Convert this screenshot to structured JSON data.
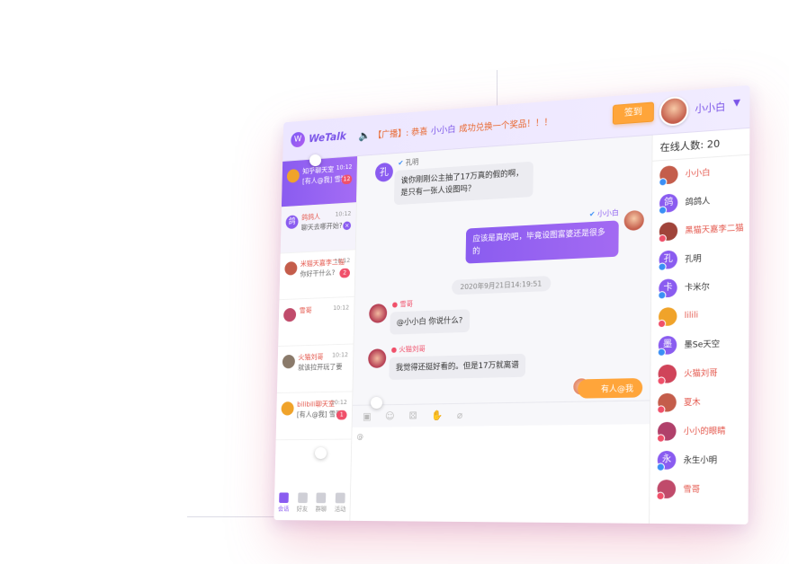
{
  "app": {
    "name": "WeTalk",
    "logo_glyph": "W"
  },
  "topbar": {
    "broadcast_prefix": "【广播】: 恭喜",
    "broadcast_user": "小小白",
    "broadcast_suffix": "成功兑换一个奖品！！！",
    "checkin_label": "签到",
    "me_name": "小小白",
    "caret": "▼"
  },
  "conversations": [
    {
      "name": "知乎聊天室",
      "msg": "[有人@我] 雪猫：你好~",
      "time": "10:12",
      "badge": "12",
      "avatar": "",
      "avatar_color": "#f0a32a",
      "state": "active"
    },
    {
      "name": "鸽鸽人",
      "msg": "聊天去哪开始?",
      "time": "10:12",
      "badge": "×",
      "avatar": "鸽",
      "avatar_color": "#8a5cf0",
      "state": "selected"
    },
    {
      "name": "米猫天嘉李二猫",
      "msg": "你好干什么?",
      "time": "10:12",
      "badge": "2",
      "avatar": "",
      "avatar_color": "#c45d4b",
      "state": ""
    },
    {
      "name": "雪哥",
      "msg": "",
      "time": "10:12",
      "badge": "",
      "avatar": "",
      "avatar_color": "#c04b6b",
      "state": ""
    },
    {
      "name": "火猫刘哥",
      "msg": "就该拉开玩了要",
      "time": "10:12",
      "badge": "",
      "avatar": "",
      "avatar_color": "#8a7a6a",
      "state": ""
    },
    {
      "name": "bilibili聊天室",
      "msg": "[有人@我] 雪哥：来嘛",
      "time": "10:12",
      "badge": "1",
      "avatar": "",
      "avatar_color": "#f0a32a",
      "state": ""
    }
  ],
  "bottom_nav": [
    {
      "label": "会话",
      "active": true
    },
    {
      "label": "好友",
      "active": false
    },
    {
      "label": "群聊",
      "active": false
    },
    {
      "label": "活动",
      "active": false
    }
  ],
  "messages": {
    "m1_sender": "孔明",
    "m1_avatar": "孔",
    "m1_text": "诶你刚刚公主抽了17万真的假的啊，是只有一张人设图吗？",
    "m2_sender": "小小白",
    "m2_text": "应该是真的吧，毕竟设图富婆还是很多的",
    "timestamp": "2020年9月21日14:19:51",
    "m3_sender": "雪哥",
    "m3_text": "@小小白 你说什么?",
    "m4_sender": "火猫刘哥",
    "m4_text": "我觉得还挺好看的。但是17万就离谱",
    "mention_label": "有人@我"
  },
  "toolbar_icons": [
    "image-icon",
    "emoji-icon",
    "dice-icon",
    "like-icon",
    "attach-icon"
  ],
  "online": {
    "title": "在线人数: 20",
    "users": [
      {
        "name": "小小白",
        "avatar": "",
        "color": "#c45d4b",
        "name_color": "#e4574c",
        "gender": "m"
      },
      {
        "name": "鸽鸽人",
        "avatar": "鸽",
        "color": "#8a5cf0",
        "name_color": "#333333",
        "gender": "m"
      },
      {
        "name": "黑猫天嘉李二猫",
        "avatar": "",
        "color": "#a0443a",
        "name_color": "#e4574c",
        "gender": "f"
      },
      {
        "name": "孔明",
        "avatar": "孔",
        "color": "#8a5cf0",
        "name_color": "#333333",
        "gender": "m"
      },
      {
        "name": "卡米尔",
        "avatar": "卡",
        "color": "#8a5cf0",
        "name_color": "#333333",
        "gender": "m"
      },
      {
        "name": "lilili",
        "avatar": "",
        "color": "#f0a32a",
        "name_color": "#e4574c",
        "gender": "f"
      },
      {
        "name": "墨Se天空",
        "avatar": "墨",
        "color": "#8a5cf0",
        "name_color": "#333333",
        "gender": "m"
      },
      {
        "name": "火猫刘哥",
        "avatar": "",
        "color": "#d0445a",
        "name_color": "#e4574c",
        "gender": "f"
      },
      {
        "name": "夏木",
        "avatar": "",
        "color": "#c45d4b",
        "name_color": "#e4574c",
        "gender": "f"
      },
      {
        "name": "小小的眼睛",
        "avatar": "",
        "color": "#b0406a",
        "name_color": "#e4574c",
        "gender": "f"
      },
      {
        "name": "永生小明",
        "avatar": "永",
        "color": "#8a5cf0",
        "name_color": "#333333",
        "gender": "m"
      },
      {
        "name": "雪哥",
        "avatar": "",
        "color": "#c04b6b",
        "name_color": "#e4574c",
        "gender": "f"
      }
    ]
  }
}
